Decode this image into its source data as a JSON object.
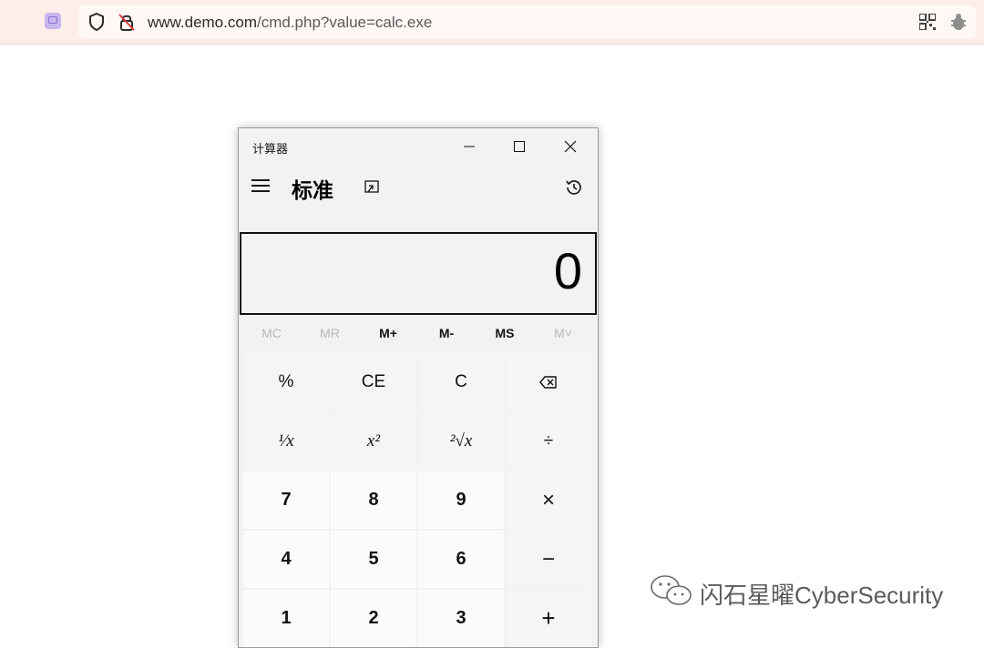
{
  "browser": {
    "url_domain": "www.demo.com",
    "url_path": "/cmd.php?value=calc.exe"
  },
  "calculator": {
    "title": "计算器",
    "mode": "标准",
    "display": "0",
    "memory": [
      "MC",
      "MR",
      "M+",
      "M-",
      "MS",
      "M˅"
    ],
    "keys": {
      "percent": "%",
      "ce": "CE",
      "c": "C",
      "reciprocal": "¹⁄x",
      "square": "x²",
      "sqrt": "²√x",
      "divide": "÷",
      "n7": "7",
      "n8": "8",
      "n9": "9",
      "multiply": "×",
      "n4": "4",
      "n5": "5",
      "n6": "6",
      "minus": "−",
      "n1": "1",
      "n2": "2",
      "n3": "3",
      "plus": "+"
    }
  },
  "watermark": "闪石星曜CyberSecurity"
}
